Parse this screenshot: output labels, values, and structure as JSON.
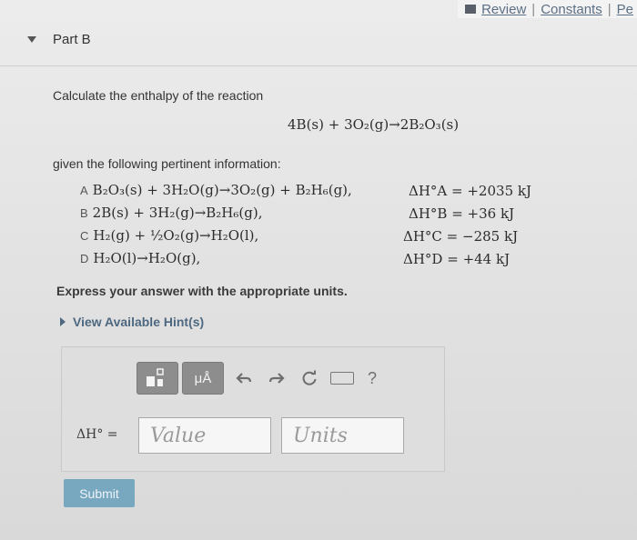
{
  "header": {
    "review": "Review",
    "separator": "|",
    "constants": "Constants",
    "separator2": "|",
    "partial": "Pe"
  },
  "part": {
    "label": "Part B"
  },
  "question": {
    "prompt": "Calculate the enthalpy of the reaction",
    "reaction": "4B(s) + 3O₂(g)→2B₂O₃(s)",
    "given": "given the following pertinent information:",
    "equations": [
      {
        "letter": "A",
        "text": "B₂O₃(s) + 3H₂O(g)→3O₂(g) + B₂H₆(g),",
        "dh_label": "ΔH°A",
        "dh_value": "= +2035 kJ"
      },
      {
        "letter": "B",
        "text": "2B(s) + 3H₂(g)→B₂H₆(g),",
        "dh_label": "ΔH°B",
        "dh_value": "= +36 kJ"
      },
      {
        "letter": "C",
        "text": "H₂(g) + ½O₂(g)→H₂O(l),",
        "dh_label": "ΔH°C",
        "dh_value": "= −285 kJ"
      },
      {
        "letter": "D",
        "text": "H₂O(l)→H₂O(g),",
        "dh_label": "ΔH°D",
        "dh_value": "= +44 kJ"
      }
    ],
    "instruction": "Express your answer with the appropriate units.",
    "hints": "View Available Hint(s)"
  },
  "answer": {
    "units_button": "μÅ",
    "help": "?",
    "label": "ΔH° =",
    "value_placeholder": "Value",
    "units_placeholder": "Units",
    "submit": "Submit"
  }
}
